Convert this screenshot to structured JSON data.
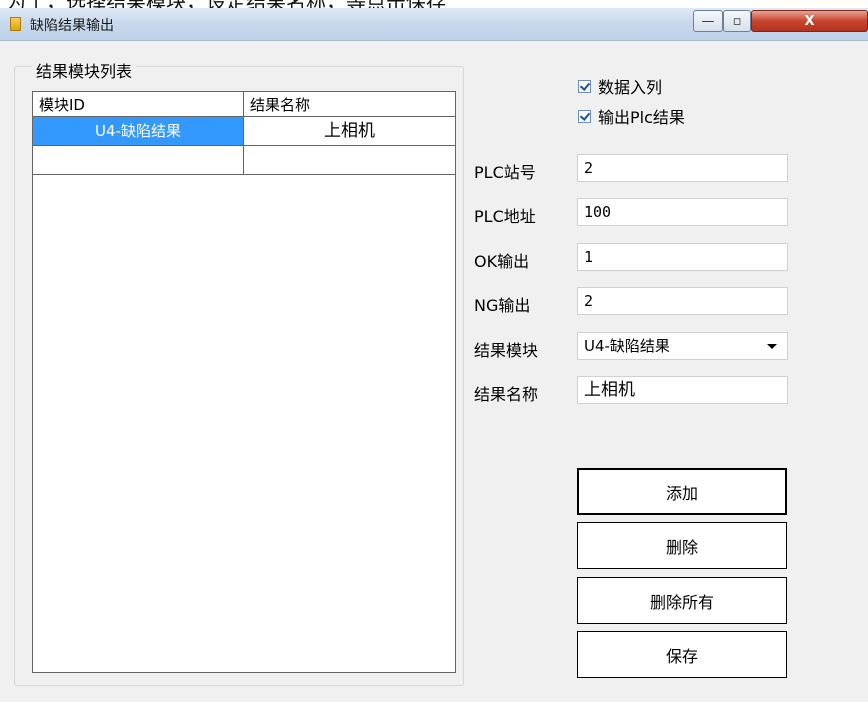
{
  "top_strip": {
    "text": "为了，选择结果模块，设定结果名称，等点击保存"
  },
  "window": {
    "title": "缺陷结果输出",
    "controls": {
      "minimize": "—",
      "maximize": "▫",
      "close": "X"
    }
  },
  "result_list": {
    "group_label": "结果模块列表",
    "columns": [
      "模块ID",
      "结果名称"
    ],
    "rows": [
      {
        "module_id": "U4-缺陷结果",
        "result_name": "上相机",
        "selected": true
      },
      {
        "module_id": "",
        "result_name": "",
        "selected": false
      }
    ]
  },
  "options": {
    "data_enqueue": {
      "label": "数据入列",
      "checked": true
    },
    "output_plc": {
      "label": "输出Plc结果",
      "checked": true
    }
  },
  "fields": {
    "plc_station": {
      "label": "PLC站号",
      "value": "2"
    },
    "plc_address": {
      "label": "PLC地址",
      "value": "100"
    },
    "ok_output": {
      "label": "OK输出",
      "value": "1"
    },
    "ng_output": {
      "label": "NG输出",
      "value": "2"
    },
    "result_module": {
      "label": "结果模块",
      "value": "U4-缺陷结果"
    },
    "result_name": {
      "label": "结果名称",
      "value": "上相机"
    }
  },
  "buttons": {
    "add": "添加",
    "delete": "删除",
    "delete_all": "删除所有",
    "save": "保存"
  },
  "colors": {
    "selection": "#3399ff",
    "window_bg": "#f0f0f0",
    "close_button": "#c8442e"
  }
}
